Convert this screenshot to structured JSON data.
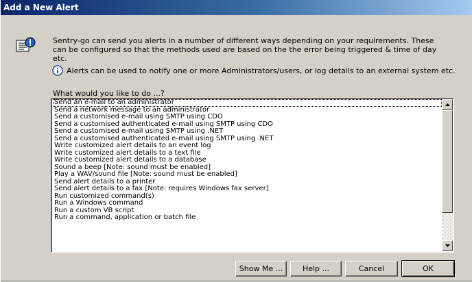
{
  "window": {
    "title": "Add a New Alert"
  },
  "description": "Sentry-go can send you alerts in a number of different ways depending on your requirements. These can be configured so that the methods used are based on the the error being triggered & time of day etc.",
  "info": "Alerts can be used to notify one or more Administrators/users, or log details to an external system etc.",
  "question": "What would you like to do ...?",
  "list": {
    "items": [
      "Send an e-mail to an administrator",
      "Send a network message to an administrator",
      "Send a customised e-mail using SMTP using CDO",
      "Send a customised authenticated e-mail using SMTP using CDO",
      "Send a customised e-mail using SMTP using .NET",
      "Send a customised authenticated e-mail using SMTP using .NET",
      "Write customized alert details to an event log",
      "Write customized alert details to a text file",
      "Write customized alert details to a database",
      "Sound a beep [Note: sound must be enabled]",
      "Play a WAV/sound file [Note: sound must be enabled]",
      "Send alert details to a printer",
      "Send alert details to a fax [Note: requires Windows fax server]",
      "Run customized command(s)",
      "Run a Windows command",
      "Run a custom VB script",
      "Run a command, application or batch file"
    ],
    "selected_index": 0
  },
  "buttons": {
    "show_me": "Show Me ...",
    "help": "Help ...",
    "cancel": "Cancel",
    "ok": "OK"
  },
  "icons": {
    "alert": "alert-config-icon",
    "info": "info-icon",
    "scroll_up": "scroll-up-arrow-icon",
    "scroll_down": "scroll-down-arrow-icon"
  }
}
